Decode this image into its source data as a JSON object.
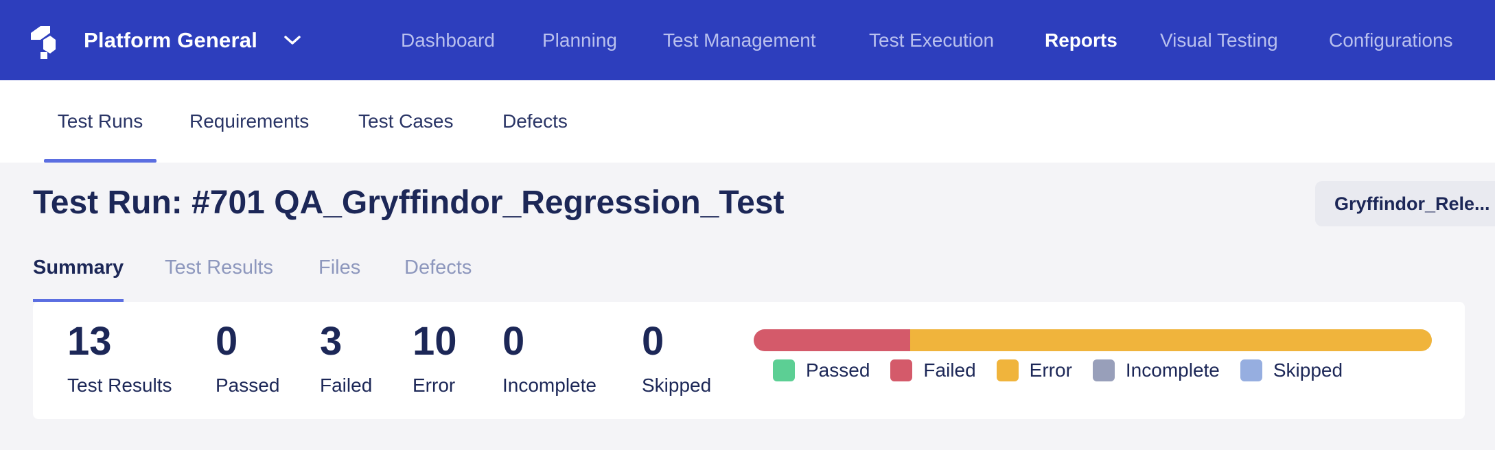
{
  "topnav": {
    "logo_icon": "platform-logo-icon",
    "workspace_name": "Platform General",
    "workspace_menu_icon": "chevron-down-icon",
    "items": [
      {
        "label": "Dashboard",
        "active": false
      },
      {
        "label": "Planning",
        "active": false
      },
      {
        "label": "Test Management",
        "active": false
      },
      {
        "label": "Test Execution",
        "active": false
      },
      {
        "label": "Reports",
        "active": true
      },
      {
        "label": "Visual Testing",
        "active": false
      },
      {
        "label": "Configurations",
        "active": false
      }
    ],
    "background_color": "#2d3ebd"
  },
  "subnav": {
    "tabs": [
      {
        "label": "Test Runs",
        "active": true
      },
      {
        "label": "Requirements",
        "active": false
      },
      {
        "label": "Test Cases",
        "active": false
      },
      {
        "label": "Defects",
        "active": false
      }
    ]
  },
  "page": {
    "title": "Test Run: #701 QA_Gryffindor_Regression_Test",
    "release_chip": "Gryffindor_Rele..."
  },
  "inner_tabs": [
    {
      "label": "Summary",
      "active": true
    },
    {
      "label": "Test Results",
      "active": false
    },
    {
      "label": "Files",
      "active": false
    },
    {
      "label": "Defects",
      "active": false
    }
  ],
  "summary": {
    "stats": [
      {
        "value": "13",
        "label": "Test Results"
      },
      {
        "value": "0",
        "label": "Passed"
      },
      {
        "value": "3",
        "label": "Failed"
      },
      {
        "value": "10",
        "label": "Error"
      },
      {
        "value": "0",
        "label": "Incomplete"
      },
      {
        "value": "0",
        "label": "Skipped"
      }
    ],
    "progress": {
      "total": 13,
      "segments": [
        {
          "name": "Passed",
          "count": 0,
          "color": "#5ccf94"
        },
        {
          "name": "Failed",
          "count": 3,
          "color": "#d45a6a"
        },
        {
          "name": "Error",
          "count": 10,
          "color": "#f0b43c"
        },
        {
          "name": "Incomplete",
          "count": 0,
          "color": "#989fba"
        },
        {
          "name": "Skipped",
          "count": 0,
          "color": "#96aee0"
        }
      ]
    },
    "legend": [
      {
        "label": "Passed",
        "color": "#5ccf94"
      },
      {
        "label": "Failed",
        "color": "#d45a6a"
      },
      {
        "label": "Error",
        "color": "#f0b43c"
      },
      {
        "label": "Incomplete",
        "color": "#989fba"
      },
      {
        "label": "Skipped",
        "color": "#96aee0"
      }
    ]
  }
}
